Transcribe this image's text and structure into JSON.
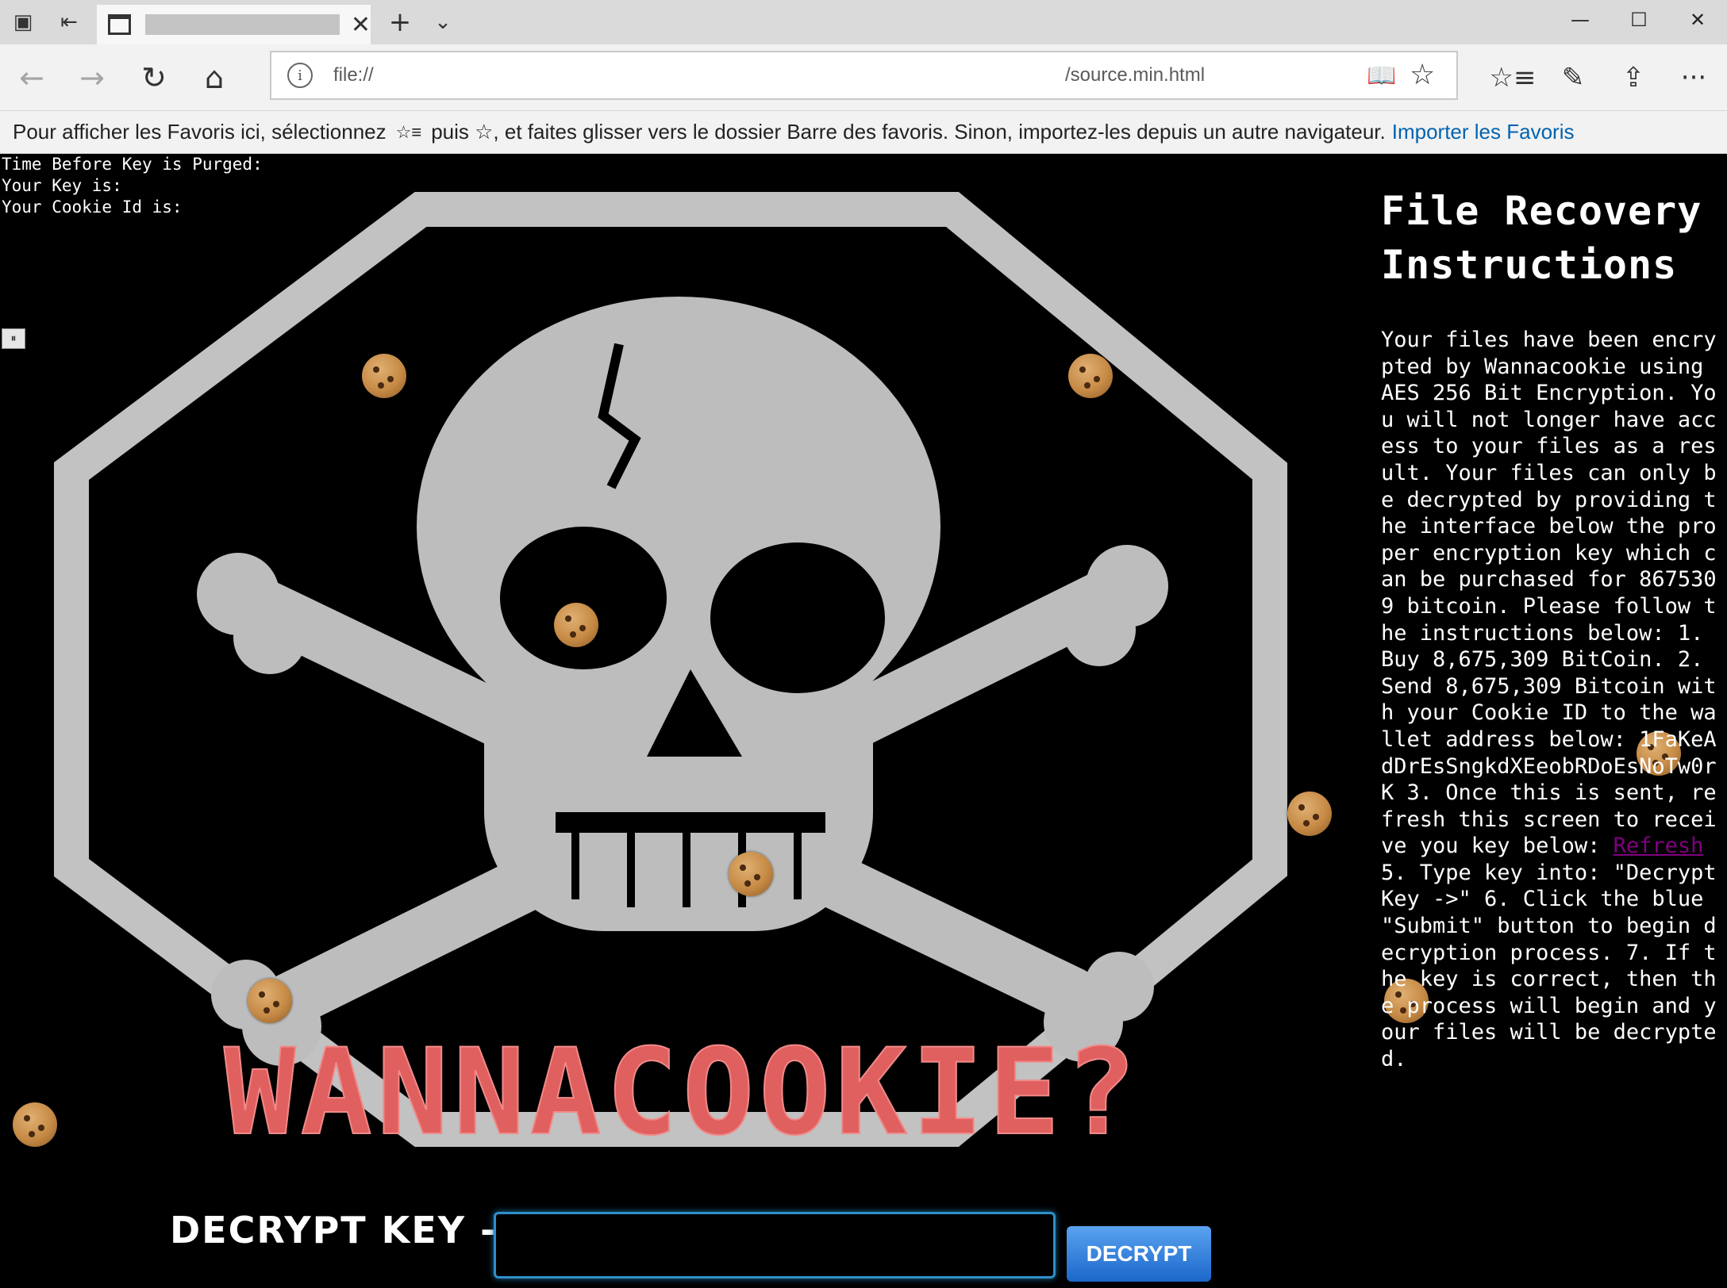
{
  "browser": {
    "tab": {
      "close_glyph": "✕"
    },
    "new_tab_glyph": "+",
    "tab_list_glyph": "⌄",
    "window_controls": {
      "minimize": "—",
      "maximize": "☐",
      "close": "✕"
    },
    "nav": {
      "back": "←",
      "forward": "→",
      "refresh": "↻",
      "home": "⌂"
    },
    "address": {
      "scheme": "file://",
      "path": "/source.min.html",
      "info_glyph": "i"
    },
    "tools": {
      "reading_view": "📖",
      "favorite": "☆",
      "favorites_hub": "☆≡",
      "notes": "✎",
      "share": "⇪",
      "more": "···"
    }
  },
  "favorites_bar": {
    "message_pre": "Pour afficher les Favoris ici, sélectionnez",
    "glyph": "☆≡",
    "message_post": "puis ☆, et faites glisser vers le dossier Barre des favoris. Sinon, importez-les depuis un autre navigateur.",
    "import_link": "Importer les Favoris"
  },
  "page": {
    "status": {
      "time_label": "Time Before Key is Purged:",
      "key_label": "Your Key is:",
      "cookie_label": "Your Cookie Id is:"
    },
    "pause_glyph": "⏸",
    "banner_text": "WANNACOOKIE?",
    "instructions": {
      "title": "File Recovery Instructions",
      "body_before_link": " Your files have been encrypted by Wannacookie using AES 256 Bit Encryption. You will not longer have access to your files as a result. Your files can only be decrypted by providing the interface below the proper encryption key which can be purchased for 8675309 bitcoin. Please follow the instructions below: 1. Buy 8,675,309 BitCoin. 2. Send 8,675,309 Bitcoin with your Cookie ID to the wallet address below: 1FaKeAdDrEsSngkdXEeobRDoEsNoTw0rK 3. Once this is sent, refresh this screen to receive you key below:",
      "refresh_link": "Refresh",
      "body_after_link": " 5. Type key into: \"Decrypt Key ->\" 6. Click the blue \"Submit\" button to begin decryption process. 7. If the key is correct, then the process will begin and your files will be decrypted."
    },
    "decrypt": {
      "label": "DECRYPT KEY ->",
      "input_value": "",
      "button": "DECRYPT"
    }
  },
  "colors": {
    "banner_red": "#e0605f",
    "skull_gray": "#b9b9b9",
    "link_purple": "#800080",
    "input_border": "#2e8fc9",
    "button_blue": "#1b67c9"
  }
}
